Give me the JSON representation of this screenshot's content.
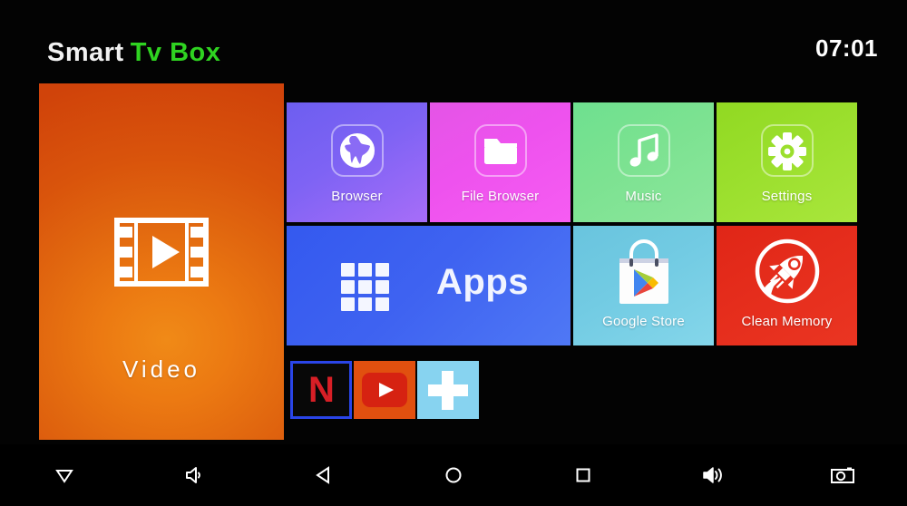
{
  "header": {
    "title_part1": "Smart",
    "title_part2": "Tv Box",
    "clock": "07:01",
    "title_color_1": "#f2f2f2",
    "title_color_2": "#2fd321"
  },
  "video_tile": {
    "label": "Video",
    "icon": "film-play-icon",
    "color": "#e1670f"
  },
  "tiles": [
    {
      "label": "Browser",
      "icon": "globe-icon",
      "color": "#7e63f4"
    },
    {
      "label": "File Browser",
      "icon": "folder-icon",
      "color": "#ee52ee"
    },
    {
      "label": "Music",
      "icon": "music-note-icon",
      "color": "#7ce291"
    },
    {
      "label": "Settings",
      "icon": "gear-icon",
      "color": "#9bdf2d"
    },
    {
      "label": "Apps",
      "icon": "grid-apps-icon",
      "color": "#3f63f1"
    },
    {
      "label": "Google Store",
      "icon": "play-store-icon",
      "color": "#72cbe3"
    },
    {
      "label": "Clean Memory",
      "icon": "rocket-icon",
      "color": "#e52d1c"
    }
  ],
  "shortcuts": [
    {
      "name": "Netflix",
      "icon": "netflix-icon",
      "glyph": "N",
      "color": "#d81f26"
    },
    {
      "name": "YouTube",
      "icon": "youtube-icon",
      "color": "#d62211"
    },
    {
      "name": "Add shortcut",
      "icon": "plus-icon",
      "color": "#87d3f0"
    }
  ],
  "navbar": [
    {
      "name": "hide-bar",
      "icon": "triangle-down-icon"
    },
    {
      "name": "volume-down",
      "icon": "volume-low-icon"
    },
    {
      "name": "back",
      "icon": "triangle-left-icon"
    },
    {
      "name": "home",
      "icon": "circle-icon"
    },
    {
      "name": "recents",
      "icon": "square-icon"
    },
    {
      "name": "volume-up",
      "icon": "volume-high-icon"
    },
    {
      "name": "screenshot",
      "icon": "camera-icon"
    }
  ]
}
